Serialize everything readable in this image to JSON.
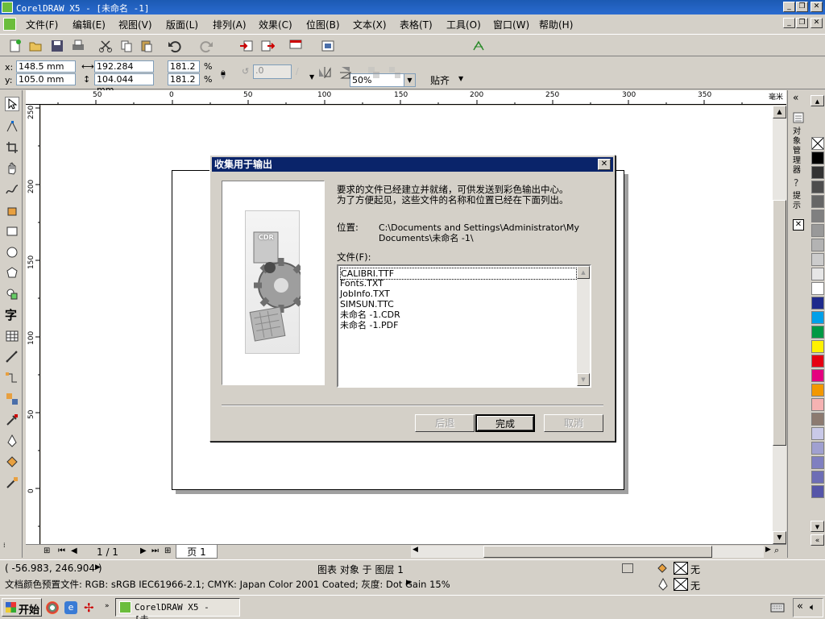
{
  "window": {
    "title": "CorelDRAW X5 - [未命名 -1]"
  },
  "menu": [
    "文件(F)",
    "编辑(E)",
    "视图(V)",
    "版面(L)",
    "排列(A)",
    "效果(C)",
    "位图(B)",
    "文本(X)",
    "表格(T)",
    "工具(O)",
    "窗口(W)",
    "帮助(H)"
  ],
  "toolbar": {
    "zoom": "50%",
    "snap": "贴齐"
  },
  "propbar": {
    "x_label": "x:",
    "x": "148.5 mm",
    "y_label": "y:",
    "y": "105.0 mm",
    "w": "192.284 mm",
    "h": "104.044 mm",
    "sx": "181.2",
    "sy": "181.2",
    "pct": "%",
    "angle": ".0"
  },
  "ruler": {
    "h": [
      "50",
      "0",
      "50",
      "100",
      "150",
      "200",
      "250",
      "300",
      "350"
    ],
    "h_unit": "毫米",
    "v": [
      "250",
      "200",
      "150",
      "100",
      "50",
      "0"
    ]
  },
  "docker": {
    "obj_mgr": "对象管理器",
    "hint": "提示"
  },
  "pagenav": {
    "counter": "1 / 1",
    "tab": "页 1"
  },
  "status": {
    "coords": "( -56.983, 246.904 )",
    "layer": "图表 对象 于 图层 1",
    "fill_none": "无",
    "outline_none": "无",
    "profile": "文档颜色预置文件: RGB: sRGB IEC61966-2.1; CMYK: Japan Color 2001 Coated; 灰度: Dot Gain 15%"
  },
  "taskbar": {
    "start": "开始",
    "task": "CorelDRAW X5 - [未..."
  },
  "dialog": {
    "title": "收集用于输出",
    "intro_line1": "要求的文件已经建立并就绪，可供发送到彩色输出中心。",
    "intro_line2": "为了方便起见，这些文件的名称和位置已经在下面列出。",
    "location_label": "位置:",
    "location_line1": "C:\\Documents and Settings\\Administrator\\My",
    "location_line2": "Documents\\未命名 -1\\",
    "files_label": "文件(F):",
    "files": [
      "CALIBRI.TTF",
      "Fonts.TXT",
      "JobInfo.TXT",
      "SIMSUN.TTC",
      "未命名 -1.CDR",
      "未命名 -1.PDF"
    ],
    "btn_back": "后退",
    "btn_finish": "完成",
    "btn_cancel": "取消",
    "image_label": "CDR"
  },
  "palette": [
    "#ffffff",
    "#000000",
    "#333333",
    "#4d4d4d",
    "#666666",
    "#808080",
    "#999999",
    "#b3b3b3",
    "#cccccc",
    "#e6e6e6",
    "#ffffff",
    "#1f2a8c",
    "#00a0e9",
    "#009944",
    "#fff100",
    "#e60012",
    "#e4007f",
    "#f39800",
    "#f5b2b2",
    "#8c7a70",
    "#c9c9e8",
    "#a0a0d0",
    "#7f7fc0",
    "#6d6db5",
    "#5555a8"
  ]
}
